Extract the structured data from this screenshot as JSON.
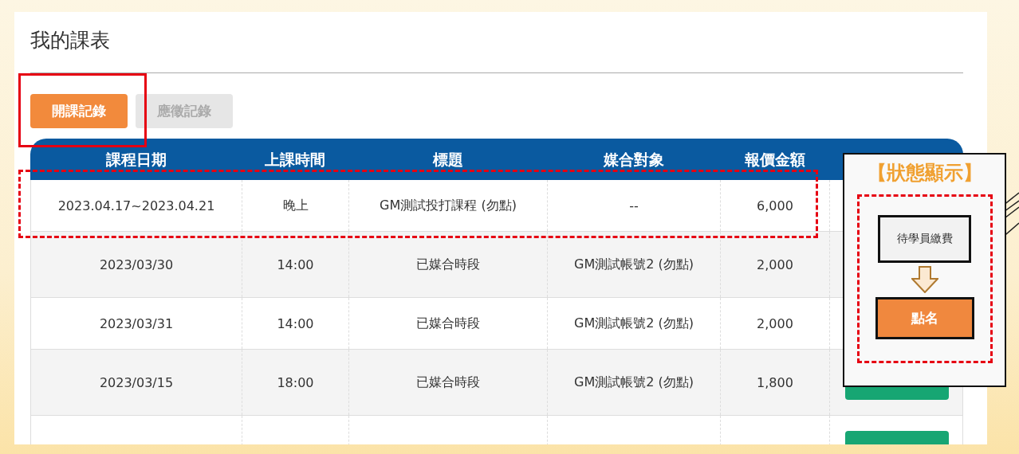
{
  "page": {
    "title": "我的課表"
  },
  "tabs": [
    {
      "label": "開課記錄",
      "selected": true
    },
    {
      "label": "應徵記錄",
      "selected": false
    }
  ],
  "table": {
    "columns": [
      "課程日期",
      "上課時間",
      "標題",
      "媒合對象",
      "報價金額"
    ],
    "rows": [
      {
        "cells": [
          "2023.04.17~2023.04.21",
          "晚上",
          "GM測試投打課程 (勿點)",
          "--",
          "6,000"
        ],
        "status": {
          "kind": "hidden"
        }
      },
      {
        "cells": [
          "2023/03/30",
          "14:00",
          "已媒合時段",
          "GM測試帳號2 (勿點)",
          "2,000"
        ],
        "status": {
          "kind": "hidden"
        }
      },
      {
        "cells": [
          "2023/03/31",
          "14:00",
          "已媒合時段",
          "GM測試帳號2 (勿點)",
          "2,000"
        ],
        "status": {
          "kind": "hidden"
        }
      },
      {
        "cells": [
          "2023/03/15",
          "18:00",
          "已媒合時段",
          "GM測試帳號2 (勿點)",
          "1,800"
        ],
        "status": {
          "kind": "green-button"
        }
      },
      {
        "cells": [],
        "status": {
          "kind": "green-button"
        }
      }
    ]
  },
  "annotation": {
    "title": "【狀態顯示】",
    "from_state": "待學員繳費",
    "to_state": "點名"
  }
}
